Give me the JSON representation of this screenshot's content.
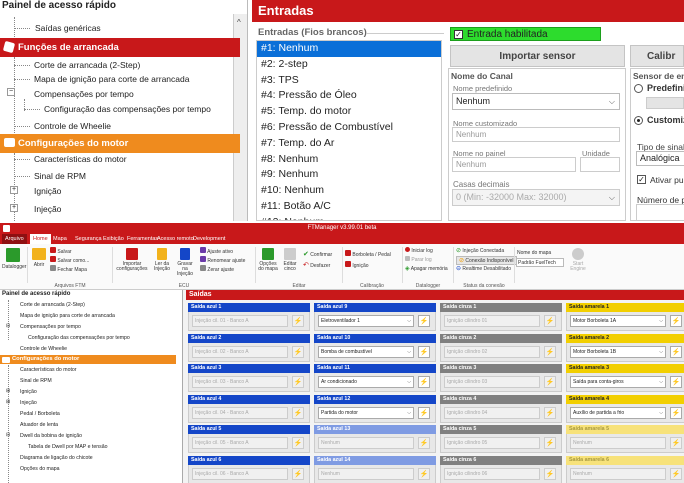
{
  "top": {
    "quick_access": {
      "title": "Painel de acesso rápido",
      "items": [
        {
          "label": "Saídas genéricas"
        },
        {
          "label": "Funções de arrancada"
        },
        {
          "label": "Corte de arrancada (2-Step)"
        },
        {
          "label": "Mapa de ignição para corte de arrancada"
        },
        {
          "label": "Compensações por tempo"
        },
        {
          "label": "Configuração das compensações por tempo"
        },
        {
          "label": "Controle de Wheelie"
        },
        {
          "label": "Configurações do motor"
        },
        {
          "label": "Características do motor"
        },
        {
          "label": "Sinal de RPM"
        },
        {
          "label": "Ignição"
        },
        {
          "label": "Injeção"
        }
      ]
    },
    "entradas": {
      "title": "Entradas",
      "list_title": "Entradas (Fios brancos)",
      "items": [
        "#1: Nenhum",
        "#2: 2-step",
        "#3: TPS",
        "#4: Pressão de Óleo",
        "#5: Temp. do motor",
        "#6: Pressão de Combustível",
        "#7: Temp. do Ar",
        "#8: Nenhum",
        "#9: Nenhum",
        "#10: Nenhum",
        "#11: Botão A/C",
        "#12: Nenhum"
      ],
      "selected_index": 0,
      "entrada_habilitada": "Entrada habilitada",
      "importar_sensor": "Importar sensor",
      "calib": "Calibr",
      "nome_canal": "Nome do Canal",
      "nome_predefinido_label": "Nome predefinido",
      "nome_predefinido_value": "Nenhum",
      "nome_customizado_label": "Nome customizado",
      "nome_customizado_value": "Nenhum",
      "nome_painel_label": "Nome no painel",
      "nome_painel_value": "Nenhum",
      "unidade_label": "Unidade",
      "casas_decimais_label": "Casas decimais",
      "casas_decimais_value": "0 (Min: -32000  Max: 32000)",
      "sensor_title": "Sensor de ent",
      "predefinido": "Predefinid",
      "customiza": "Customiza",
      "tipo_sinal_label": "Tipo de sinal",
      "tipo_sinal_value": "Analógica",
      "ativar_pulu": "Ativar pulu",
      "numero_po": "Número de po"
    }
  },
  "bottom": {
    "window_title": "FTManager v3.99.01 beta",
    "menus": [
      "Arquivo",
      "Home",
      "Mapa",
      "Segurança",
      "Exibição",
      "Ferramentas",
      "Acesso remoto",
      "Development"
    ],
    "active_menu": 1,
    "ribbon": {
      "datalogger": "Datalogger",
      "abrir": "Abrir",
      "salvar": "Salvar",
      "salvar_como": "Salvar como...",
      "fechar_mapa": "Fechar Mapa",
      "arquivos_ftm": "Arquivos FTM",
      "importar": "Importar configurações",
      "ler_da_injecao": "Ler da Injeção",
      "gravar_na_injecao": "Gravar na Injeção",
      "ajuste_ativo": "Ajuste ativo",
      "renomear_ajuste": "Renomear ajuste",
      "zerar_ajuste": "Zerar ajuste",
      "ecu": "ECU",
      "opcoes_do_mapa": "Opções do mapa",
      "editar_cinco": "Editar cinco",
      "confirmar": "Confirmar",
      "desfazer": "Desfazer",
      "editar": "Editar",
      "borboleta_pedal": "Borboleta / Pedal",
      "ignicao": "Ignição",
      "calibracao": "Calibração",
      "iniciar_log": "Iniciar log",
      "parar_log": "Parar log",
      "apagar_memoria": "Apagar memória",
      "datalogger_grp": "Datalogger",
      "injecao_conectada": "Injeção Conectada",
      "conexao_indisponivel": "Conexão Indisponível",
      "realtime_desabilitado": "Realtime Desabilitado",
      "status_conexao": "Status da conexão",
      "nome_do_mapa": "Nome do mapa",
      "padrao_fueltech": "Padrão FuelTech",
      "start_engine": "Start Engine"
    },
    "left_panel": {
      "title": "Painel de acesso rápido",
      "items": [
        "Corte de arrancada (2-Step)",
        "Mapa de ignição para corte de arrancada",
        "Compensações por tempo",
        "Configuração das compensações por tempo",
        "Controle de Wheelie",
        "Configurações do motor",
        "Características do motor",
        "Sinal de RPM",
        "Ignição",
        "Injeção",
        "Pedal / Borboleta",
        "Atuador de lenta",
        "Dwell da bobina de ignição",
        "Tabela de Dwell por MAP e tensão",
        "Diagrama de ligação do chicote",
        "Opções do mapa"
      ]
    },
    "saidas_title": "Saídas",
    "colors": {
      "blue": "#1446c8",
      "gray": "#808080",
      "yellow": "#f2cf00",
      "red": "#c8181a",
      "orange": "#ef8b1e"
    },
    "columns": [
      {
        "color": "blue",
        "cards": [
          {
            "title": "Saída azul 1",
            "value": "Injeção cil. 01 - Banco A",
            "enabled": false
          },
          {
            "title": "Saída azul 2",
            "value": "Injeção cil. 02 - Banco A",
            "enabled": false
          },
          {
            "title": "Saída azul 3",
            "value": "Injeção cil. 03 - Banco A",
            "enabled": false
          },
          {
            "title": "Saída azul 4",
            "value": "Injeção cil. 04 - Banco A",
            "enabled": false
          },
          {
            "title": "Saída azul 5",
            "value": "Injeção cil. 05 - Banco A",
            "enabled": false
          },
          {
            "title": "Saída azul 6",
            "value": "Injeção cil. 06 - Banco A",
            "enabled": false
          }
        ]
      },
      {
        "color": "blue",
        "cards": [
          {
            "title": "Saída azul 9",
            "value": "Eletroventilador 1",
            "enabled": true
          },
          {
            "title": "Saída azul 10",
            "value": "Bomba de combustível",
            "enabled": true
          },
          {
            "title": "Saída azul 11",
            "value": "Ar condicionado",
            "enabled": true
          },
          {
            "title": "Saída azul 12",
            "value": "Partida do motor",
            "enabled": true
          },
          {
            "title": "Saída azul 13",
            "value": "Nenhum",
            "enabled": false,
            "faded": true
          },
          {
            "title": "Saída azul 14",
            "value": "Nenhum",
            "enabled": false,
            "faded": true
          }
        ]
      },
      {
        "color": "gray",
        "cards": [
          {
            "title": "Saída cinza 1",
            "value": "Ignição cilindro 01",
            "enabled": false
          },
          {
            "title": "Saída cinza 2",
            "value": "Ignição cilindro 02",
            "enabled": false
          },
          {
            "title": "Saída cinza 3",
            "value": "Ignição cilindro 03",
            "enabled": false
          },
          {
            "title": "Saída cinza 4",
            "value": "Ignição cilindro 04",
            "enabled": false
          },
          {
            "title": "Saída cinza 5",
            "value": "Ignição cilindro 05",
            "enabled": false
          },
          {
            "title": "Saída cinza 6",
            "value": "Ignição cilindro 06",
            "enabled": false
          }
        ]
      },
      {
        "color": "yellow",
        "cards": [
          {
            "title": "Saída amarela 1",
            "value": "Motor Borboleta 1A",
            "enabled": true
          },
          {
            "title": "Saída amarela 2",
            "value": "Motor Borboleta 1B",
            "enabled": true
          },
          {
            "title": "Saída amarela 3",
            "value": "Saída para conta-giros",
            "enabled": true
          },
          {
            "title": "Saída amarela 4",
            "value": "Auxílio de partida a frio",
            "enabled": true
          },
          {
            "title": "Saída amarela 5",
            "value": "Nenhum",
            "enabled": false,
            "faded": true
          },
          {
            "title": "Saída amarela 6",
            "value": "Nenhum",
            "enabled": false,
            "faded": true
          }
        ]
      }
    ]
  }
}
